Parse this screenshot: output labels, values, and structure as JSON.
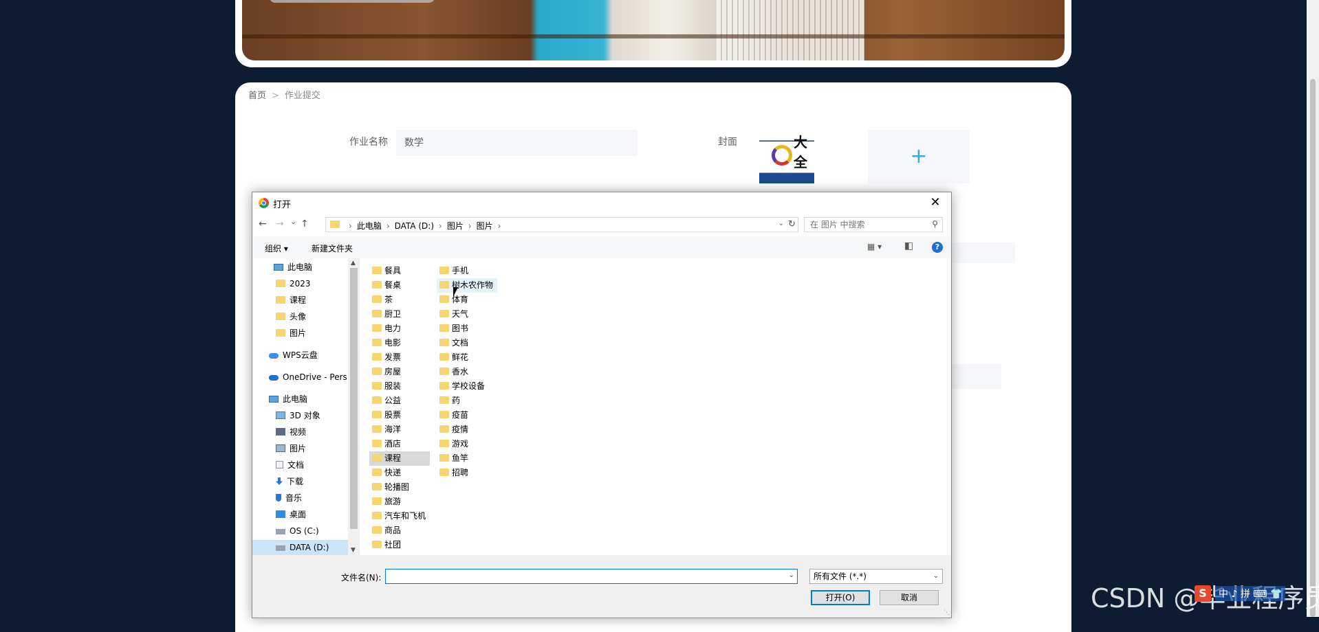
{
  "banner": {},
  "breadcrumb": {
    "home": "首页",
    "separator": ">",
    "current": "作业提交"
  },
  "form": {
    "name_label": "作业名称",
    "name_value": "数学",
    "cover_label": "封面",
    "cover_thumb_text": "大全",
    "upload_icon": "+"
  },
  "dialog": {
    "title": "打开",
    "close": "✕",
    "nav": {
      "back": "←",
      "forward": "→",
      "recent": "⌄",
      "up": "↑"
    },
    "path": [
      "此电脑",
      "DATA (D:)",
      "图片",
      "图片"
    ],
    "path_sep": "›",
    "search_placeholder": "在 图片 中搜索",
    "toolbar": {
      "organize": "组织 ▾",
      "new_folder": "新建文件夹",
      "view_icon": "▦ ▾",
      "pane_icon": "◧",
      "help": "?"
    },
    "nav_pane": [
      {
        "label": "此电脑",
        "icon": "pc-icon"
      },
      {
        "label": "2023",
        "icon": "folder-icon"
      },
      {
        "label": "课程",
        "icon": "folder-icon"
      },
      {
        "label": "头像",
        "icon": "folder-icon"
      },
      {
        "label": "图片",
        "icon": "folder-icon"
      },
      {
        "label": "WPS云盘",
        "icon": "cloud-icon"
      },
      {
        "label": "OneDrive - Pers",
        "icon": "onedrive-icon"
      },
      {
        "label": "此电脑",
        "icon": "pc-icon"
      },
      {
        "label": "3D 对象",
        "icon": "3d-objects-icon"
      },
      {
        "label": "视频",
        "icon": "video-icon"
      },
      {
        "label": "图片",
        "icon": "pictures-icon"
      },
      {
        "label": "文档",
        "icon": "documents-icon"
      },
      {
        "label": "下载",
        "icon": "download-icon"
      },
      {
        "label": "音乐",
        "icon": "music-icon"
      },
      {
        "label": "桌面",
        "icon": "desktop-icon"
      },
      {
        "label": "OS (C:)",
        "icon": "drive-icon"
      },
      {
        "label": "DATA (D:)",
        "icon": "drive-icon",
        "selected": true
      }
    ],
    "folders_col1": [
      "餐具",
      "餐桌",
      "茶",
      "厨卫",
      "电力",
      "电影",
      "发票",
      "房屋",
      "服装",
      "公益",
      "股票",
      "海洋",
      "酒店",
      "课程",
      "快递",
      "轮播图",
      "旅游",
      "汽车和飞机",
      "商品",
      "社团"
    ],
    "folders_col2": [
      "手机",
      "树木农作物",
      "体育",
      "天气",
      "图书",
      "文档",
      "鲜花",
      "香水",
      "学校设备",
      "药",
      "疫苗",
      "疫情",
      "游戏",
      "鱼竿",
      "招聘"
    ],
    "selected_folder": "课程",
    "hover_folder": "树木农作物",
    "filename_label": "文件名(N):",
    "filename_value": "",
    "filetype": "所有文件 (*.*)",
    "open_button": "打开(O)",
    "cancel_button": "取消"
  },
  "watermark": {
    "text": "CSDN @毕业程序员",
    "ime_logo": "S",
    "ime_text": "中 ♪ 拼 ⌨ 👕"
  },
  "colors": {
    "page_bg": "#0d1b33",
    "accent": "#3fa9d8",
    "dialog_focus": "#0078d7"
  }
}
